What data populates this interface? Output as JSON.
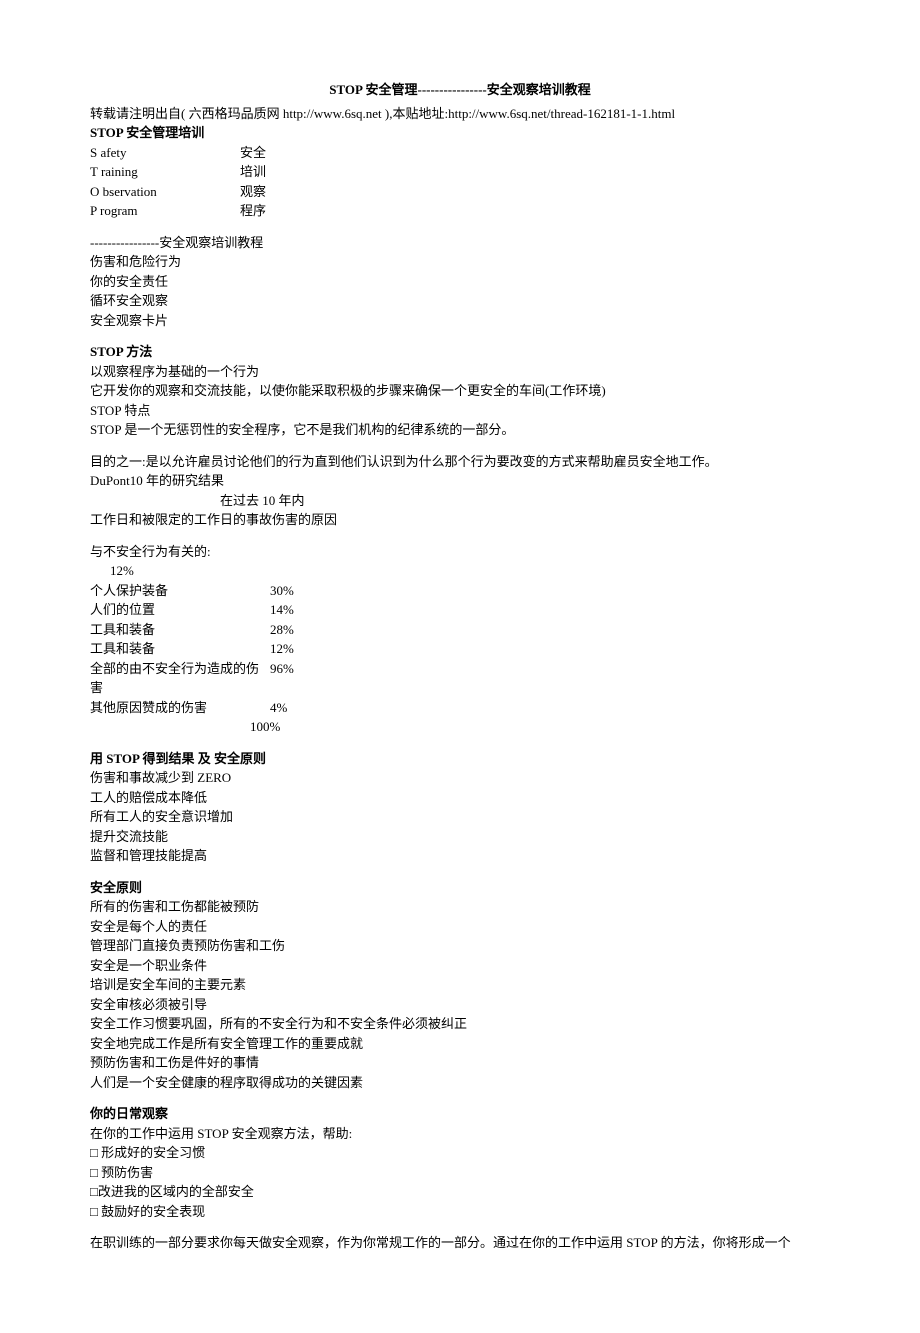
{
  "title": "STOP 安全管理----------------安全观察培训教程",
  "source": "转载请注明出自( 六西格玛品质网 http://www.6sq.net ),本贴地址:http://www.6sq.net/thread-162181-1-1.html",
  "heading1": "STOP 安全管理培训",
  "acronym": {
    "s": {
      "left": "S afety",
      "right": "安全"
    },
    "t": {
      "left": "T raining",
      "right": "培训"
    },
    "o": {
      "left": "O bservation",
      "right": "观察"
    },
    "p": {
      "left": "P rogram",
      "right": "程序"
    }
  },
  "subtitle_dashes": "----------------安全观察培训教程",
  "topics": {
    "t1": "伤害和危险行为",
    "t2": "你的安全责任",
    "t3": "循环安全观察",
    "t4": "安全观察卡片"
  },
  "heading2": "STOP 方法",
  "method": {
    "l1": "以观察程序为基础的一个行为",
    "l2": "它开发你的观察和交流技能，以使你能采取积极的步骤来确保一个更安全的车间(工作环境)",
    "l3": "STOP 特点",
    "l4": "STOP 是一个无惩罚性的安全程序，它不是我们机构的纪律系统的一部分。"
  },
  "purpose": {
    "l1": "目的之一:是以允许雇员讨论他们的行为直到他们认识到为什么那个行为要改变的方式来帮助雇员安全地工作。",
    "l2": "DuPont10 年的研究结果",
    "l3": "在过去 10 年内",
    "l4": "工作日和被限定的工作日的事故伤害的原因"
  },
  "stats_header": "与不安全行为有关的:",
  "stats_12": "12%",
  "stats": {
    "r1": {
      "label": "个人保护装备",
      "value": "30%"
    },
    "r2": {
      "label": "人们的位置",
      "value": "14%"
    },
    "r3": {
      "label": "工具和装备",
      "value": "28%"
    },
    "r4": {
      "label": "工具和装备",
      "value": "12%"
    },
    "r5": {
      "label": "全部的由不安全行为造成的伤害",
      "value": "96%"
    },
    "r6": {
      "label": "其他原因赞成的伤害",
      "value": "4%"
    }
  },
  "stats_total": "100%",
  "heading3": "用 STOP 得到结果  及  安全原则",
  "results": {
    "l1": "伤害和事故减少到 ZERO",
    "l2": "工人的赔偿成本降低",
    "l3": "所有工人的安全意识增加",
    "l4": "提升交流技能",
    "l5": "监督和管理技能提高"
  },
  "heading4": "安全原则",
  "principles": {
    "l1": "所有的伤害和工伤都能被预防",
    "l2": "安全是每个人的责任",
    "l3": "管理部门直接负责预防伤害和工伤",
    "l4": "安全是一个职业条件",
    "l5": "培训是安全车间的主要元素",
    "l6": "安全审核必须被引导",
    "l7": "安全工作习惯要巩固，所有的不安全行为和不安全条件必须被纠正",
    "l8": "安全地完成工作是所有安全管理工作的重要成就",
    "l9": "预防伤害和工伤是件好的事情",
    "l10": "人们是一个安全健康的程序取得成功的关键因素"
  },
  "heading5": "你的日常观察",
  "daily": {
    "intro": "在你的工作中运用 STOP 安全观察方法，帮助:",
    "c1": "□ 形成好的安全习惯",
    "c2": "□ 预防伤害",
    "c3": "□改进我的区域内的全部安全",
    "c4": "□ 鼓励好的安全表现"
  },
  "closing": "在职训练的一部分要求你每天做安全观察，作为你常规工作的一部分。通过在你的工作中运用 STOP 的方法，你将形成一个"
}
